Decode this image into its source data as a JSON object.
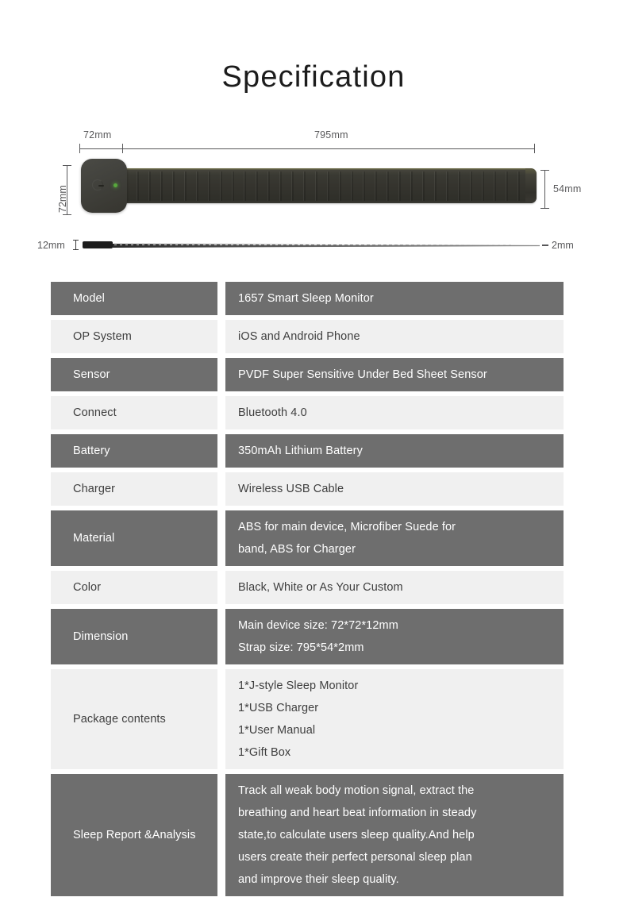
{
  "title": "Specification",
  "diagram": {
    "top_dim_left": "72mm",
    "top_dim_right": "795mm",
    "left_dim": "72mm",
    "right_dim": "54mm",
    "side_dim_left": "12mm",
    "side_dim_right": "2mm",
    "side_dash": "–"
  },
  "table": {
    "rows": [
      {
        "style": "dark",
        "key": "Model",
        "value_lines": [
          "1657 Smart Sleep Monitor"
        ]
      },
      {
        "style": "light",
        "key": "OP System",
        "value_lines": [
          "iOS and Android Phone"
        ]
      },
      {
        "style": "dark",
        "key": "Sensor",
        "value_lines": [
          "PVDF Super Sensitive Under Bed Sheet Sensor"
        ]
      },
      {
        "style": "light",
        "key": "Connect",
        "value_lines": [
          "Bluetooth 4.0"
        ]
      },
      {
        "style": "dark",
        "key": "Battery",
        "value_lines": [
          "350mAh Lithium Battery"
        ]
      },
      {
        "style": "light",
        "key": "Charger",
        "value_lines": [
          "Wireless USB Cable"
        ]
      },
      {
        "style": "dark",
        "key": "Material",
        "value_lines": [
          "ABS for main device, Microfiber Suede for",
          "band, ABS for Charger"
        ]
      },
      {
        "style": "light",
        "key": "Color",
        "value_lines": [
          "Black, White or As Your Custom"
        ]
      },
      {
        "style": "dark",
        "key": "Dimension",
        "value_lines": [
          "Main device size: 72*72*12mm",
          "Strap size: 795*54*2mm"
        ]
      },
      {
        "style": "light",
        "key": "Package contents",
        "value_lines": [
          "1*J-style Sleep Monitor",
          "1*USB Charger",
          "1*User Manual",
          "1*Gift Box"
        ]
      },
      {
        "style": "dark",
        "key": "Sleep Report & Analysis",
        "key_lines": [
          "Sleep Report &",
          "Analysis"
        ],
        "value_lines": [
          "Track all weak body motion signal, extract the",
          "breathing and heart beat information in steady",
          "state,to calculate users sleep quality.And help",
          "users create their perfect personal sleep plan",
          "and improve their sleep quality."
        ]
      }
    ]
  },
  "colors": {
    "row_dark": "#6e6e6e",
    "row_light": "#f0f0f0",
    "text_dark": "#3e3e3e",
    "text_light": "#ffffff",
    "dimension_line": "#58585a",
    "device_body": "#36352f",
    "led_green": "#57a83c"
  }
}
